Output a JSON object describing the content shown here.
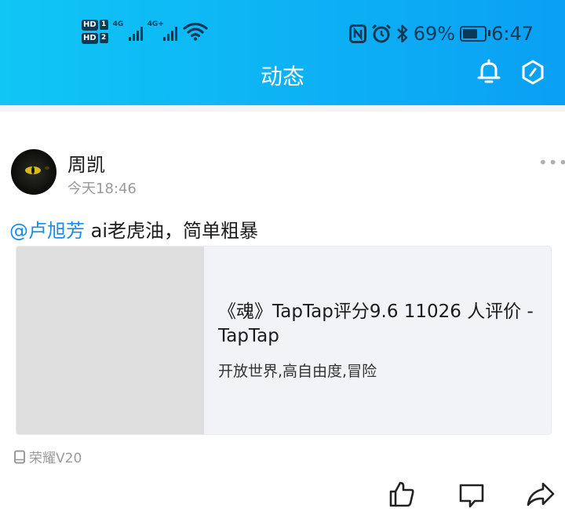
{
  "status_bar": {
    "hd1": "HD",
    "hd1_num": "1",
    "hd2": "HD",
    "hd2_num": "2",
    "sim1_type": "4G",
    "sim2_type": "4G+",
    "battery_percent": "69%",
    "battery_level": 0.69,
    "time": "6:47"
  },
  "header": {
    "title": "动态"
  },
  "post": {
    "author": "周凯",
    "time": "今天18:46",
    "more": "•••",
    "mention": "@卢旭芳",
    "text": " ai老虎油，简单粗暴",
    "link_card": {
      "title": "《魂》TapTap评分9.6 11026 人评价 - TapTap",
      "subtitle": "开放世界,高自由度,冒险"
    },
    "device": "荣耀V20"
  },
  "colors": {
    "header_gradient_start": "#10c6f5",
    "header_gradient_end": "#0aa0f4",
    "mention": "#1a8be6"
  },
  "icons": [
    "bell-icon",
    "hexagon-settings-icon",
    "thumbs-up-icon",
    "comment-icon",
    "share-icon",
    "phone-icon"
  ]
}
